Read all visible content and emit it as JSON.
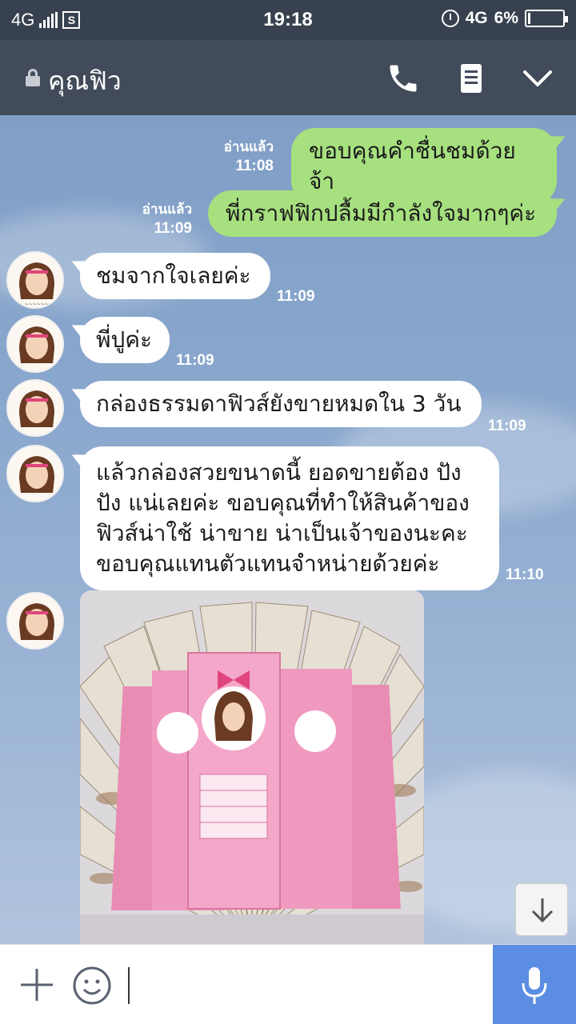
{
  "status_bar": {
    "network_left": "4G",
    "sim_label": "S",
    "time": "19:18",
    "network_right": "4G",
    "battery": "6%",
    "battery_level": 0.06
  },
  "header": {
    "title": "คุณฟิว",
    "icons": [
      "lock-icon",
      "phone-icon",
      "note-icon",
      "chevron-down-icon"
    ]
  },
  "messages": [
    {
      "side": "out",
      "text": "ขอบคุณคำชื่นชมด้วยจ้า",
      "read": "อ่านแล้ว",
      "time": "11:08"
    },
    {
      "side": "out",
      "text": "พี่กราฟฟิกปลื้มมีกำลังใจมากๆค่ะ",
      "read": "อ่านแล้ว",
      "time": "11:09"
    },
    {
      "side": "in",
      "text": "ชมจากใจเลยค่ะ",
      "time": "11:09"
    },
    {
      "side": "in",
      "text": "พี่ปูค่ะ",
      "time": "11:09"
    },
    {
      "side": "in",
      "text": "กล่องธรรมดาฟิวส์ยังขายหมดใน 3 วัน",
      "time": "11:09"
    },
    {
      "side": "in",
      "lines": [
        "แล้วกล่องสวยขนาดนี้ ยอดขายต้อง ปัง",
        "ปัง แน่เลยค่ะ ขอบคุณที่ทำให้สินค้าของ",
        "ฟิวส์น่าใช้ น่าขาย น่าเป็นเจ้าของนะคะ",
        "ขอบคุณแทนตัวแทนจำหน่ายด้วยค่ะ"
      ],
      "time": "11:10"
    },
    {
      "side": "in",
      "type": "photo",
      "photo_desc": "pink product boxes on banknotes"
    }
  ],
  "colors": {
    "status_bar": "#37414f",
    "header": "#414b5a",
    "bubble_out": "#a6e07f",
    "bubble_in": "#ffffff",
    "mic_button": "#5b8de3"
  }
}
